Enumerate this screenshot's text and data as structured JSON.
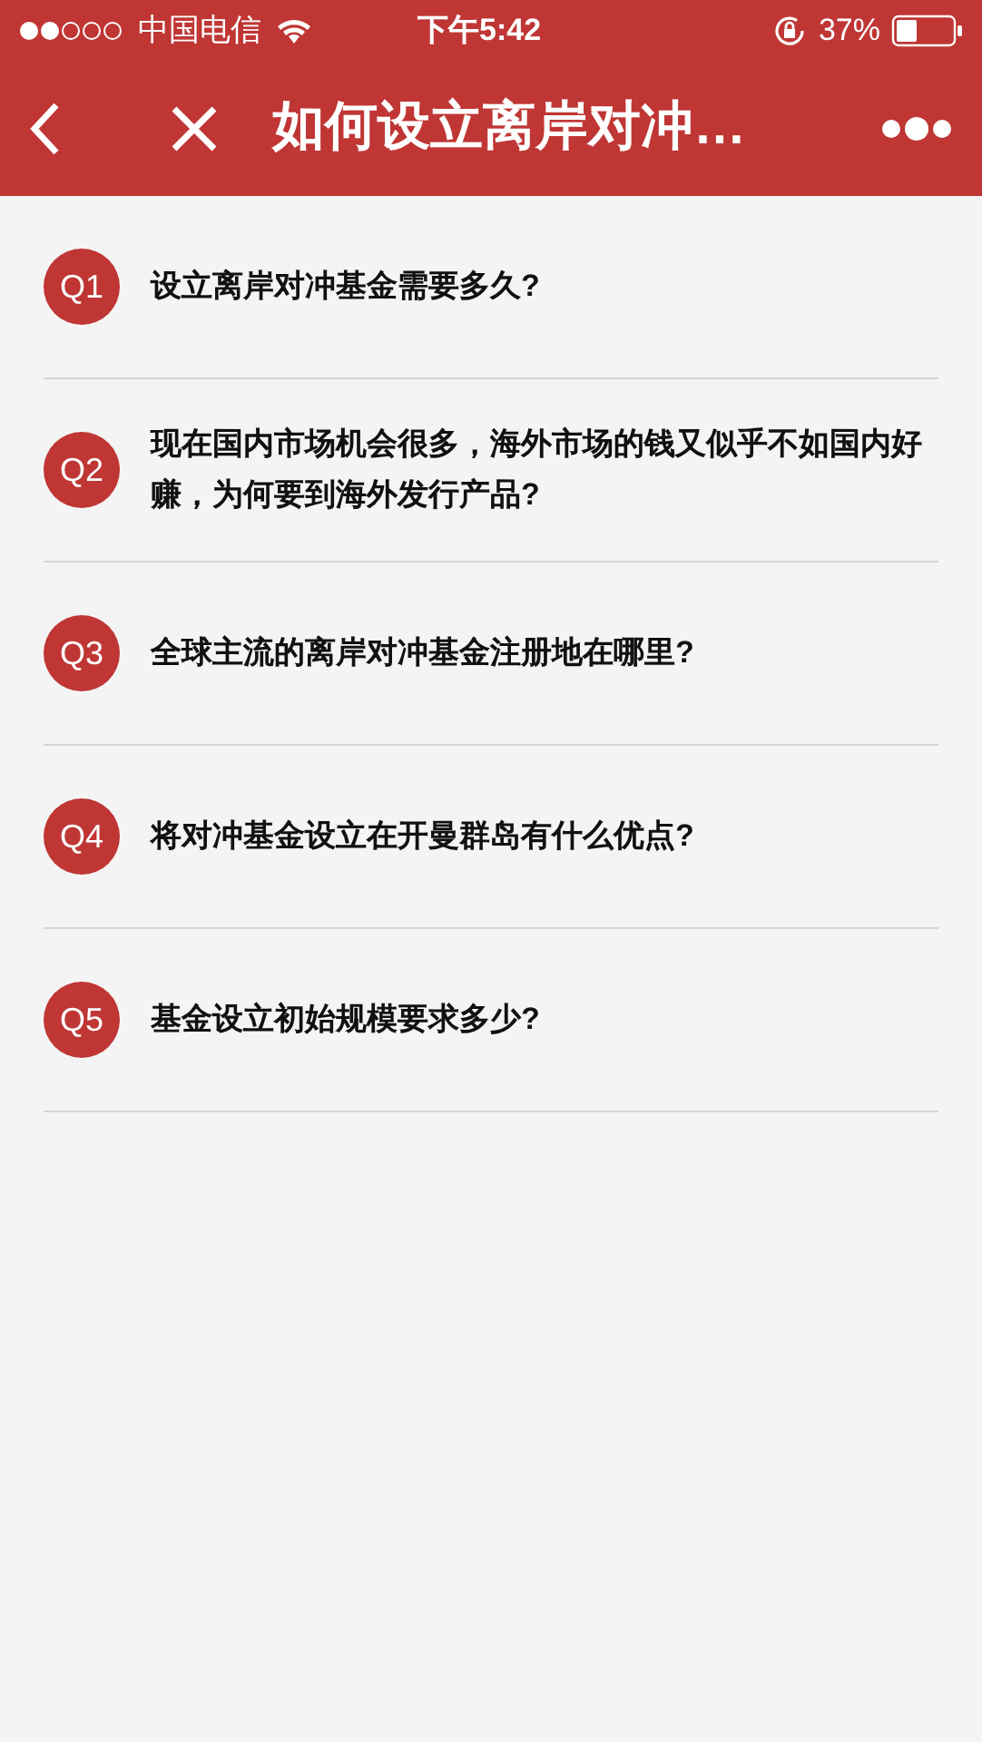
{
  "status_bar": {
    "carrier": "中国电信",
    "time": "下午5:42",
    "battery": "37%"
  },
  "nav_bar": {
    "title": "如何设立离岸对冲…"
  },
  "questions": [
    {
      "badge": "Q1",
      "text": "设立离岸对冲基金需要多久?"
    },
    {
      "badge": "Q2",
      "text": "现在国内市场机会很多，海外市场的钱又似乎不如国内好赚，为何要到海外发行产品?"
    },
    {
      "badge": "Q3",
      "text": "全球主流的离岸对冲基金注册地在哪里?"
    },
    {
      "badge": "Q4",
      "text": "将对冲基金设立在开曼群岛有什么优点?"
    },
    {
      "badge": "Q5",
      "text": "基金设立初始规模要求多少?"
    }
  ]
}
